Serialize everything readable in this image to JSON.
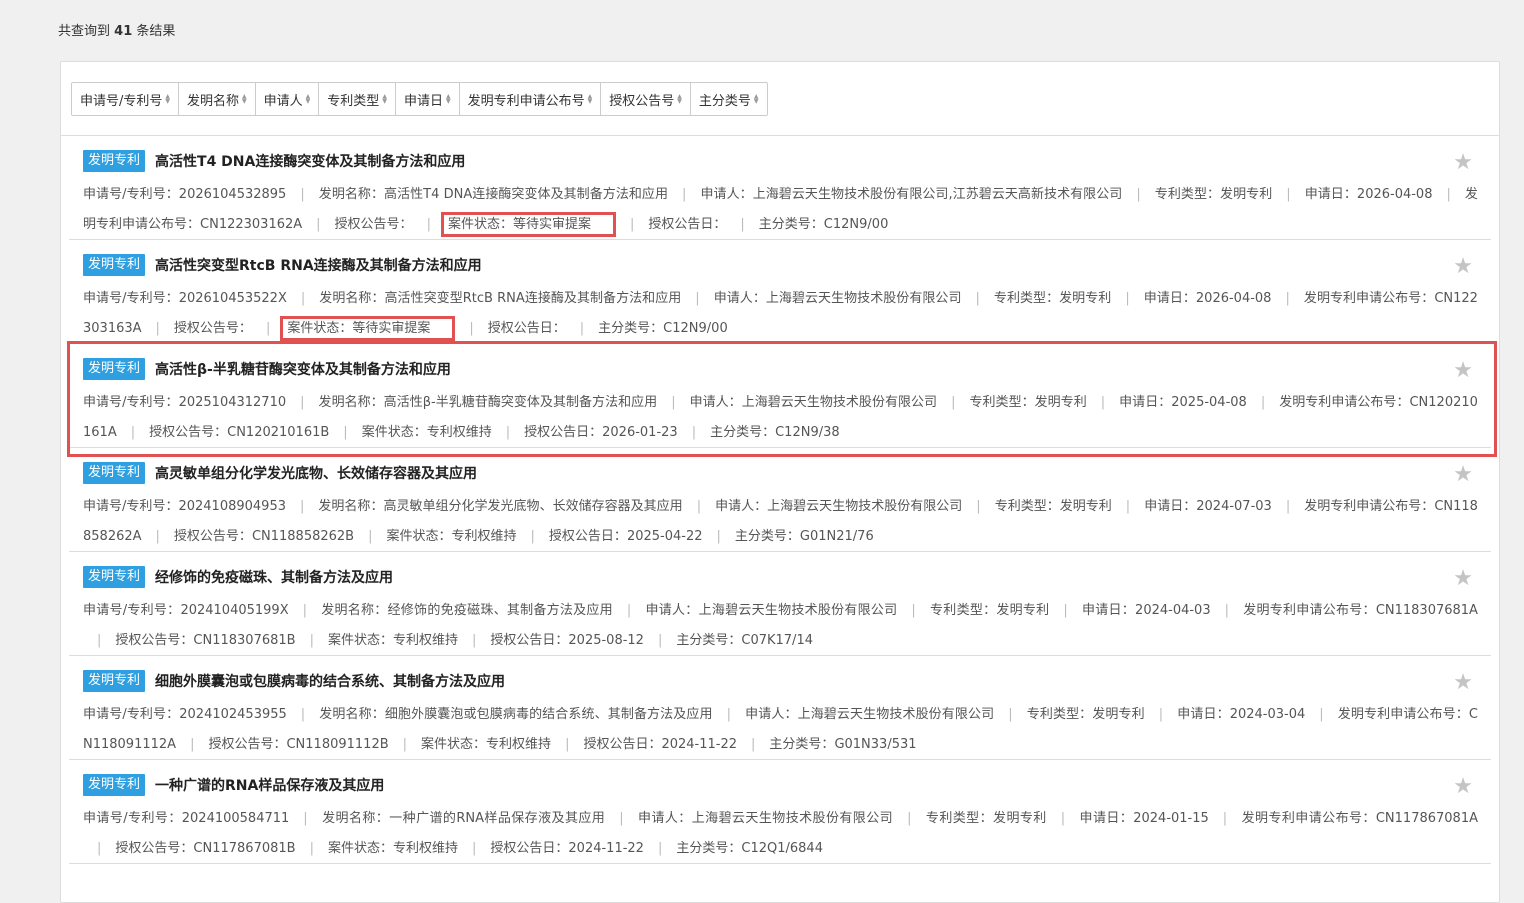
{
  "summary": {
    "prefix": "共查询到",
    "count": "41",
    "suffix": "条结果"
  },
  "sort_fields": [
    "申请号/专利号",
    "发明名称",
    "申请人",
    "专利类型",
    "申请日",
    "发明专利申请公布号",
    "授权公告号",
    "主分类号"
  ],
  "labels": {
    "app_no": "申请号/专利号：",
    "name": "发明名称：",
    "applicant": "申请人：",
    "type": "专利类型：",
    "app_date": "申请日：",
    "pub_no": "发明专利申请公布号：",
    "grant_no": "授权公告号：",
    "status": "案件状态：",
    "grant_date": "授权公告日：",
    "class": "主分类号："
  },
  "results": [
    {
      "badge": "发明专利",
      "title": "高活性T4 DNA连接酶突变体及其制备方法和应用",
      "app_no": "2026104532895",
      "name": "高活性T4 DNA连接酶突变体及其制备方法和应用",
      "applicant": "上海碧云天生物技术股份有限公司,江苏碧云天高新技术有限公司",
      "type": "发明专利",
      "app_date": "2026-04-08",
      "pub_no": "CN122303162A",
      "grant_no": "",
      "status": "等待实审提案",
      "grant_date": "",
      "class": "C12N9/00",
      "status_highlight": true
    },
    {
      "badge": "发明专利",
      "title": "高活性突变型RtcB RNA连接酶及其制备方法和应用",
      "app_no": "202610453522X",
      "name": "高活性突变型RtcB RNA连接酶及其制备方法和应用",
      "applicant": "上海碧云天生物技术股份有限公司",
      "type": "发明专利",
      "app_date": "2026-04-08",
      "pub_no": "CN122303163A",
      "grant_no": "",
      "status": "等待实审提案",
      "grant_date": "",
      "class": "C12N9/00",
      "status_highlight": true
    },
    {
      "badge": "发明专利",
      "title": "高活性β-半乳糖苷酶突变体及其制备方法和应用",
      "app_no": "2025104312710",
      "name": "高活性β-半乳糖苷酶突变体及其制备方法和应用",
      "applicant": "上海碧云天生物技术股份有限公司",
      "type": "发明专利",
      "app_date": "2025-04-08",
      "pub_no": "CN120210161A",
      "grant_no": "CN120210161B",
      "status": "专利权维持",
      "grant_date": "2026-01-23",
      "class": "C12N9/38",
      "status_highlight": false
    },
    {
      "badge": "发明专利",
      "title": "高灵敏单组分化学发光底物、长效储存容器及其应用",
      "app_no": "2024108904953",
      "name": "高灵敏单组分化学发光底物、长效储存容器及其应用",
      "applicant": "上海碧云天生物技术股份有限公司",
      "type": "发明专利",
      "app_date": "2024-07-03",
      "pub_no": "CN118858262A",
      "grant_no": "CN118858262B",
      "status": "专利权维持",
      "grant_date": "2025-04-22",
      "class": "G01N21/76",
      "status_highlight": false
    },
    {
      "badge": "发明专利",
      "title": "经修饰的免疫磁珠、其制备方法及应用",
      "app_no": "202410405199X",
      "name": "经修饰的免疫磁珠、其制备方法及应用",
      "applicant": "上海碧云天生物技术股份有限公司",
      "type": "发明专利",
      "app_date": "2024-04-03",
      "pub_no": "CN118307681A",
      "grant_no": "CN118307681B",
      "status": "专利权维持",
      "grant_date": "2025-08-12",
      "class": "C07K17/14",
      "status_highlight": false
    },
    {
      "badge": "发明专利",
      "title": "细胞外膜囊泡或包膜病毒的结合系统、其制备方法及应用",
      "app_no": "2024102453955",
      "name": "细胞外膜囊泡或包膜病毒的结合系统、其制备方法及应用",
      "applicant": "上海碧云天生物技术股份有限公司",
      "type": "发明专利",
      "app_date": "2024-03-04",
      "pub_no": "CN118091112A",
      "grant_no": "CN118091112B",
      "status": "专利权维持",
      "grant_date": "2024-11-22",
      "class": "G01N33/531",
      "status_highlight": false
    },
    {
      "badge": "发明专利",
      "title": "一种广谱的RNA样品保存液及其应用",
      "app_no": "2024100584711",
      "name": "一种广谱的RNA样品保存液及其应用",
      "applicant": "上海碧云天生物技术股份有限公司",
      "type": "发明专利",
      "app_date": "2024-01-15",
      "pub_no": "CN117867081A",
      "grant_no": "CN117867081B",
      "status": "专利权维持",
      "grant_date": "2024-11-22",
      "class": "C12Q1/6844",
      "status_highlight": false
    }
  ],
  "highlighted_row_index": 2,
  "colors": {
    "badge": "#2e9fe0",
    "highlight": "#e05252",
    "star": "#c4c4c4"
  },
  "icons": {
    "star": "star-icon",
    "sort": "sort-arrows-icon"
  }
}
